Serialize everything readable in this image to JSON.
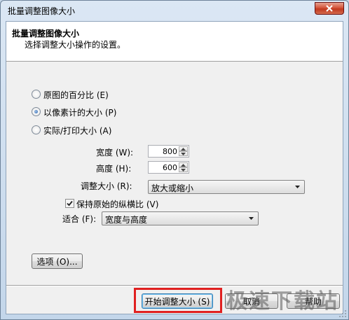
{
  "window": {
    "title": "批量调整图像大小"
  },
  "header": {
    "title": "批量调整图像大小",
    "subtitle": "选择调整大小操作的设置。"
  },
  "options": {
    "percent_label": "原图的百分比 (E)",
    "pixels_label": "以像素计的大小 (P)",
    "print_label": "实际/打印大小 (A)",
    "selected": "pixels"
  },
  "size": {
    "width_label": "宽度 (W):",
    "width_value": "800",
    "height_label": "高度 (H):",
    "height_value": "600"
  },
  "resize": {
    "label": "调整大小 (R):",
    "value": "放大或缩小"
  },
  "keep_aspect": {
    "label": "保持原始的纵横比 (V)",
    "checked": true
  },
  "fit": {
    "label": "适合 (F):",
    "value": "宽度与高度"
  },
  "buttons": {
    "options": "选项 (O)...",
    "start": "开始调整大小 (S)",
    "cancel": "取消",
    "help": "帮助"
  },
  "watermark": "极速下载站"
}
